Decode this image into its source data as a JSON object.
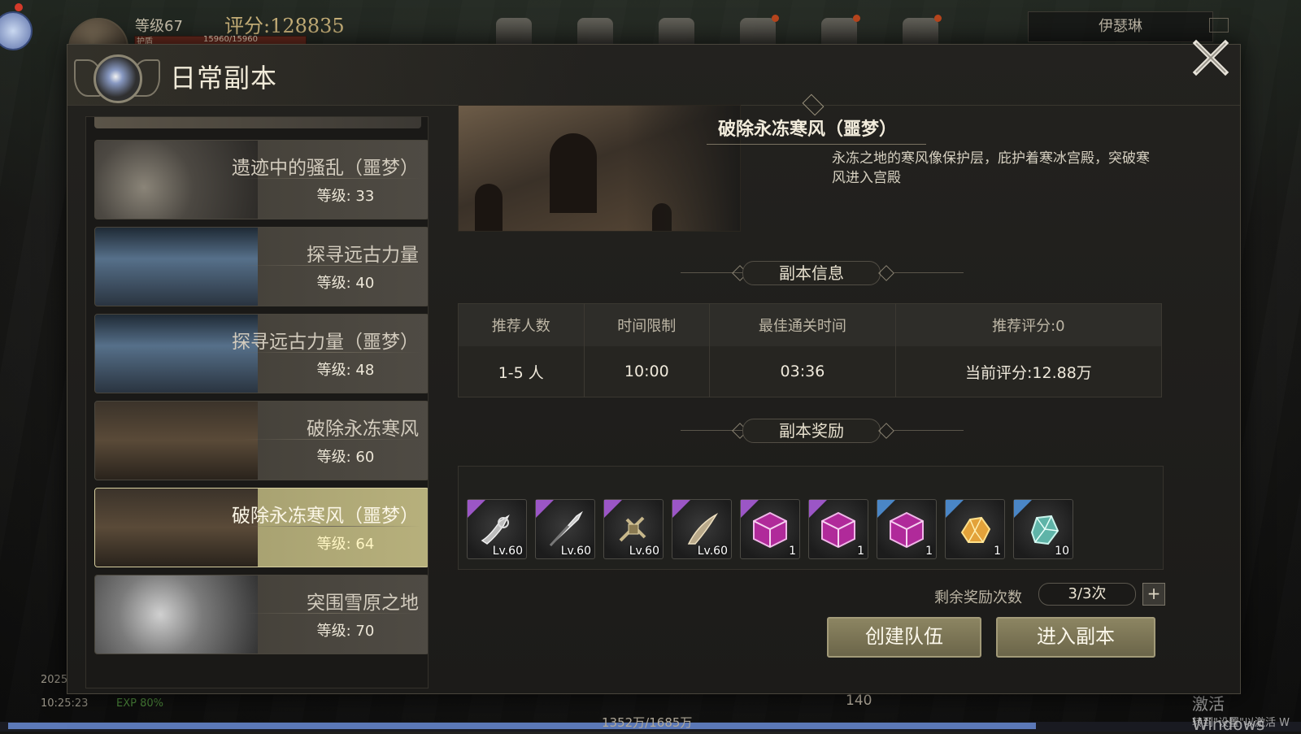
{
  "hud": {
    "level": "等级67",
    "score": "评分:128835",
    "hp_label": "护盾",
    "hp_value": "15960/15960",
    "player_name": "伊瑟琳",
    "date": "2025",
    "time": "10:25:23",
    "exp": "EXP 80%",
    "exp_progress": 0.8,
    "exp_value": "1352万/1685万",
    "counter": "140",
    "top_icons": [
      "backpack-icon",
      "shop-icon",
      "guild-icon",
      "character-icon",
      "quest-icon",
      "map-icon"
    ],
    "watermark_1": "激活 Windows",
    "watermark_2": "转到\"设置\"以激活 W"
  },
  "panel": {
    "title": "日常副本"
  },
  "dungeons": [
    {
      "name": "遗迹中的骚乱（噩梦）",
      "level": "等级: 33",
      "thumb": "spikes"
    },
    {
      "name": "探寻远古力量",
      "level": "等级: 40",
      "thumb": "tower"
    },
    {
      "name": "探寻远古力量（噩梦）",
      "level": "等级: 48",
      "thumb": "tower"
    },
    {
      "name": "破除永冻寒风",
      "level": "等级: 60",
      "thumb": "ruin"
    },
    {
      "name": "破除永冻寒风（噩梦）",
      "level": "等级: 64",
      "thumb": "ruin",
      "active": true
    },
    {
      "name": "突围雪原之地",
      "level": "等级: 70",
      "thumb": "snow"
    }
  ],
  "detail": {
    "title": "破除永冻寒风（噩梦）",
    "description": "永冻之地的寒风像保护层，庇护着寒冰宫殿，突破寒风进入宫殿",
    "info_section": "副本信息",
    "info_headers": [
      "推荐人数",
      "时间限制",
      "最佳通关时间",
      "推荐评分:0"
    ],
    "info_values": [
      "1-5 人",
      "10:00",
      "03:36",
      "当前评分:12.88万"
    ],
    "reward_section": "副本奖励",
    "rewards": [
      {
        "icon": "claw-weapon-icon",
        "badge": "Lv.60",
        "rarity": "purple"
      },
      {
        "icon": "spear-weapon-icon",
        "badge": "Lv.60",
        "rarity": "purple"
      },
      {
        "icon": "crossbow-weapon-icon",
        "badge": "Lv.60",
        "rarity": "purple"
      },
      {
        "icon": "blade-weapon-icon",
        "badge": "Lv.60",
        "rarity": "purple"
      },
      {
        "icon": "purple-box-icon",
        "badge": "1",
        "rarity": "purple"
      },
      {
        "icon": "purple-box-icon",
        "badge": "1",
        "rarity": "purple"
      },
      {
        "icon": "purple-box-icon",
        "badge": "1",
        "rarity": "blue"
      },
      {
        "icon": "gold-ore-icon",
        "badge": "1",
        "rarity": "blue"
      },
      {
        "icon": "crystal-ore-icon",
        "badge": "10",
        "rarity": "blue"
      }
    ],
    "remaining_label": "剩余奖励次数",
    "remaining_value": "3/3次",
    "create_team": "创建队伍",
    "enter_dungeon": "进入副本"
  },
  "colors": {
    "accent_gold": "#b7b07c",
    "rarity_purple": "#9b56c6",
    "rarity_blue": "#4a86c6",
    "exp_green": "#4d8a3c"
  }
}
